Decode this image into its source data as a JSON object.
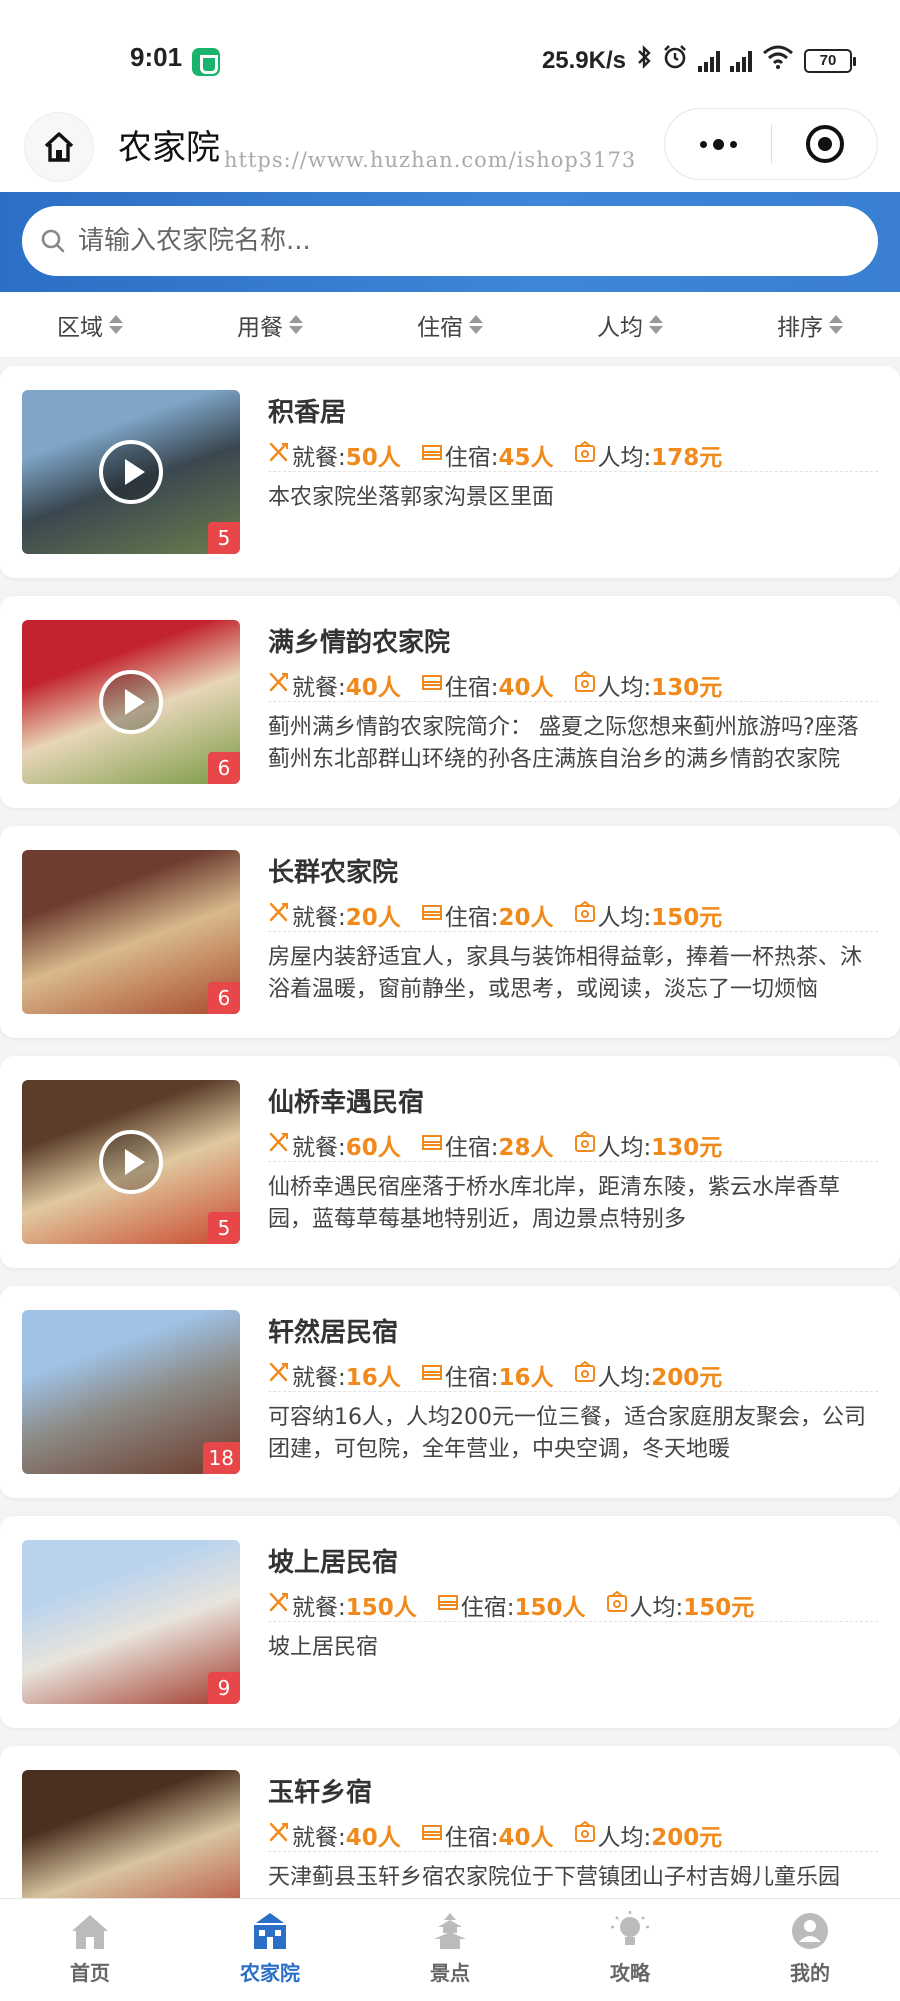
{
  "status_bar": {
    "time": "9:01",
    "network_speed": "25.9K/s",
    "battery": "70"
  },
  "nav": {
    "title": "农家院",
    "watermark": "https://www.huzhan.com/ishop3173"
  },
  "search": {
    "placeholder": "请输入农家院名称..."
  },
  "filters": [
    "区域",
    "用餐",
    "住宿",
    "人均",
    "排序"
  ],
  "labels": {
    "dining": "就餐:",
    "lodging": "住宿:",
    "per_capita": "人均:"
  },
  "listings": [
    {
      "title": "积香居",
      "dining": "50人",
      "lodging": "45人",
      "per_capita": "178元",
      "description": "本农家院坐落郭家沟景区里面",
      "media_count": "5",
      "has_video": true,
      "thumb_colors": [
        "#7fa6c9",
        "#3a4750",
        "#6b7d4d"
      ]
    },
    {
      "title": "满乡情韵农家院",
      "dining": "40人",
      "lodging": "40人",
      "per_capita": "130元",
      "description": "蓟州满乡情韵农家院简介： 盛夏之际您想来蓟州旅游吗?座落蓟州东北部群山环绕的孙各庄满族自治乡的满乡情韵农家院",
      "media_count": "6",
      "has_video": true,
      "thumb_colors": [
        "#c2232c",
        "#e7d6b8",
        "#7a9a45"
      ]
    },
    {
      "title": "长群农家院",
      "dining": "20人",
      "lodging": "20人",
      "per_capita": "150元",
      "description": "房屋内装舒适宜人，家具与装饰相得益彰，捧着一杯热茶、沐浴着温暖，窗前静坐，或思考，或阅读，淡忘了一切烦恼",
      "media_count": "6",
      "has_video": false,
      "thumb_colors": [
        "#6e3d31",
        "#d9b98c",
        "#a84a2d"
      ]
    },
    {
      "title": "仙桥幸遇民宿",
      "dining": "60人",
      "lodging": "28人",
      "per_capita": "130元",
      "description": "仙桥幸遇民宿座落于桥水库北岸，距清东陵，紫云水岸香草园，蓝莓草莓基地特别近，周边景点特别多",
      "media_count": "5",
      "has_video": true,
      "thumb_colors": [
        "#5a3d2a",
        "#e0c9a0",
        "#c9492f"
      ]
    },
    {
      "title": "轩然居民宿",
      "dining": "16人",
      "lodging": "16人",
      "per_capita": "200元",
      "description": "可容纳16人，人均200元一位三餐，适合家庭朋友聚会，公司团建，可包院，全年营业，中央空调，冬天地暖",
      "media_count": "18",
      "has_video": false,
      "thumb_colors": [
        "#9fc2e6",
        "#8c8a85",
        "#6b3a2a"
      ]
    },
    {
      "title": "坡上居民宿",
      "dining": "150人",
      "lodging": "150人",
      "per_capita": "150元",
      "description": "坡上居民宿",
      "media_count": "9",
      "has_video": false,
      "thumb_colors": [
        "#b9d3ee",
        "#e8e4dc",
        "#a23a2c"
      ]
    },
    {
      "title": "玉轩乡宿",
      "dining": "40人",
      "lodging": "40人",
      "per_capita": "200元",
      "description": "天津蓟县玉轩乡宿农家院位于下营镇团山子村吉姆儿童乐园",
      "media_count": "",
      "has_video": false,
      "thumb_colors": [
        "#4a3020",
        "#d8c4a0",
        "#b33a2a"
      ]
    }
  ],
  "tabs": [
    {
      "label": "首页",
      "icon": "home-icon",
      "active": false
    },
    {
      "label": "农家院",
      "icon": "farmhouse-icon",
      "active": true
    },
    {
      "label": "景点",
      "icon": "pagoda-icon",
      "active": false
    },
    {
      "label": "攻略",
      "icon": "lightbulb-icon",
      "active": false
    },
    {
      "label": "我的",
      "icon": "user-icon",
      "active": false
    }
  ],
  "colors": {
    "accent_blue": "#2c6fc6",
    "highlight_orange": "#f08a1c",
    "badge_red": "#e8474a"
  }
}
